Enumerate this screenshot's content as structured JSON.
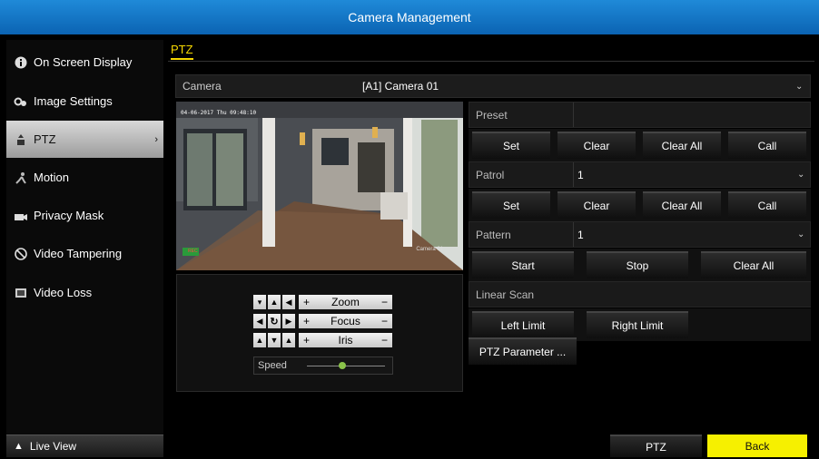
{
  "window": {
    "title": "Camera Management"
  },
  "sidebar": {
    "items": [
      {
        "label": "On Screen Display",
        "icon": "info-icon"
      },
      {
        "label": "Image Settings",
        "icon": "image-settings-icon"
      },
      {
        "label": "PTZ",
        "icon": "ptz-icon",
        "active": true,
        "chevron": "›"
      },
      {
        "label": "Motion",
        "icon": "motion-icon"
      },
      {
        "label": "Privacy Mask",
        "icon": "privacy-mask-icon"
      },
      {
        "label": "Video Tampering",
        "icon": "video-tampering-icon"
      },
      {
        "label": "Video Loss",
        "icon": "video-loss-icon"
      }
    ],
    "live_view": "Live View"
  },
  "main": {
    "tab": "PTZ",
    "camera": {
      "label": "Camera",
      "value": "[A1] Camera 01"
    },
    "video": {
      "osd_time": "04-06-2017  Thu 09:48:10",
      "osd_camera": "Camera 01",
      "rec_badge": "REC"
    },
    "controls": {
      "zoom_label": "Zoom",
      "focus_label": "Focus",
      "iris_label": "Iris",
      "plus": "+",
      "minus": "−",
      "speed_label": "Speed",
      "speed_level": 0.45
    },
    "preset": {
      "label": "Preset",
      "value": "",
      "buttons": [
        "Set",
        "Clear",
        "Clear All",
        "Call"
      ]
    },
    "patrol": {
      "label": "Patrol",
      "value": "1",
      "buttons": [
        "Set",
        "Clear",
        "Clear All",
        "Call"
      ]
    },
    "pattern": {
      "label": "Pattern",
      "value": "1",
      "buttons": [
        "Start",
        "Stop",
        "Clear All"
      ]
    },
    "linear_scan": {
      "label": "Linear Scan",
      "buttons": [
        "Left Limit",
        "Right Limit"
      ]
    },
    "ptz_parameter": "PTZ Parameter ..."
  },
  "footer": {
    "ptz": "PTZ",
    "back": "Back"
  },
  "colors": {
    "title_bar": "#0b63b3",
    "accent_yellow": "#f6d800",
    "back_button": "#f6f000"
  }
}
